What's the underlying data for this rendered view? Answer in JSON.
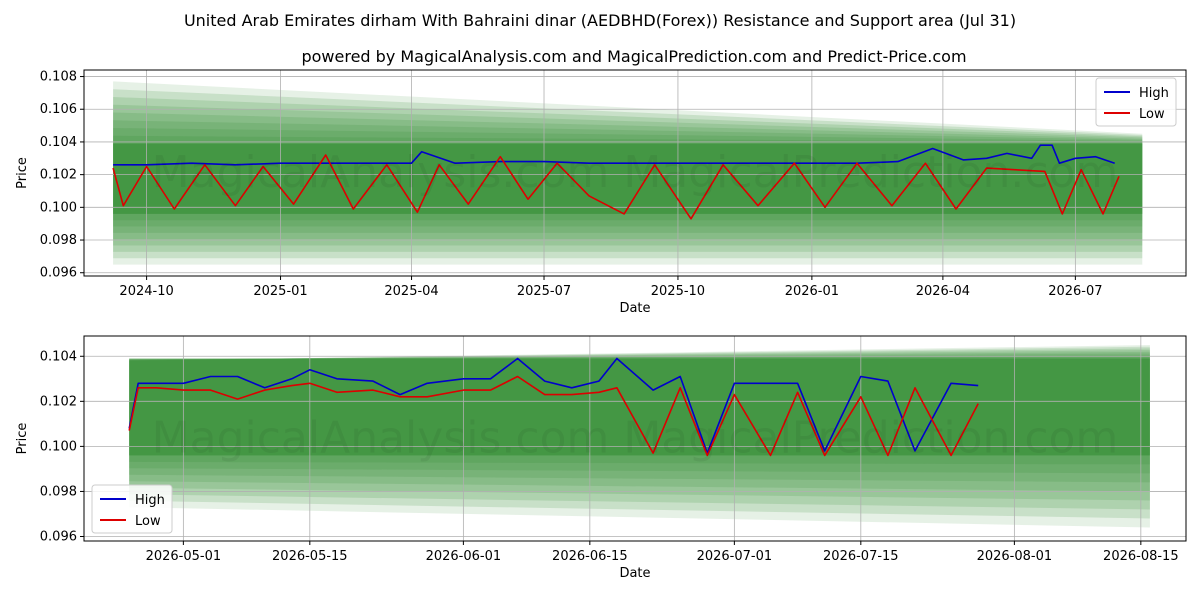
{
  "title_line1": "United Arab Emirates dirham With Bahraini dinar (AEDBHD(Forex)) Resistance and Support area (Jul 31)",
  "title_line2": "powered by MagicalAnalysis.com and MagicalPrediction.com and Predict-Price.com",
  "watermark": "MagicalAnalysis.com   MagicalPrediction.com",
  "colors": {
    "high": "#0000cc",
    "low": "#dd0000",
    "band": "#2e8b2e"
  },
  "chart_data": [
    {
      "type": "line",
      "xlabel": "Date",
      "ylabel": "Price",
      "xlim": [
        "2024-08-19",
        "2026-09-15"
      ],
      "ylim": [
        0.0958,
        0.1084
      ],
      "x_ticks": [
        "2024-10",
        "2025-01",
        "2025-04",
        "2025-07",
        "2025-10",
        "2026-01",
        "2026-04",
        "2026-07"
      ],
      "y_ticks": [
        "0.096",
        "0.098",
        "0.100",
        "0.102",
        "0.104",
        "0.106",
        "0.108"
      ],
      "legend": {
        "position": "top-right",
        "entries": [
          "High",
          "Low"
        ]
      },
      "grid": true,
      "band_start": "2024-09-08",
      "band_end": "2026-08-16",
      "band_start_range": [
        0.0965,
        0.1077
      ],
      "band_end_range": [
        0.0965,
        0.1045
      ],
      "core_band": [
        0.0996,
        0.1039
      ],
      "series": [
        {
          "name": "High",
          "x": [
            "2024-09-08",
            "2024-10-01",
            "2024-11-01",
            "2024-12-01",
            "2025-01-01",
            "2025-02-01",
            "2025-03-01",
            "2025-04-01",
            "2025-04-08",
            "2025-05-01",
            "2025-06-01",
            "2025-07-01",
            "2025-08-01",
            "2025-09-01",
            "2025-10-01",
            "2025-11-01",
            "2025-12-01",
            "2026-01-01",
            "2026-02-01",
            "2026-03-01",
            "2026-03-25",
            "2026-04-15",
            "2026-05-01",
            "2026-05-15",
            "2026-06-01",
            "2026-06-07",
            "2026-06-15",
            "2026-06-20",
            "2026-07-01",
            "2026-07-15",
            "2026-07-28"
          ],
          "values": [
            0.1026,
            0.1026,
            0.1027,
            0.1026,
            0.1027,
            0.1027,
            0.1027,
            0.1027,
            0.1034,
            0.1027,
            0.1028,
            0.1028,
            0.1027,
            0.1027,
            0.1027,
            0.1027,
            0.1027,
            0.1027,
            0.1027,
            0.1028,
            0.1036,
            0.1029,
            0.103,
            0.1033,
            0.103,
            0.1038,
            0.1038,
            0.1027,
            0.103,
            0.1031,
            0.1027
          ]
        },
        {
          "name": "Low",
          "x": [
            "2024-09-08",
            "2024-09-15",
            "2024-10-01",
            "2024-10-20",
            "2024-11-10",
            "2024-12-01",
            "2024-12-20",
            "2025-01-10",
            "2025-02-01",
            "2025-02-20",
            "2025-03-15",
            "2025-04-05",
            "2025-04-20",
            "2025-05-10",
            "2025-06-01",
            "2025-06-20",
            "2025-07-10",
            "2025-08-01",
            "2025-08-25",
            "2025-09-15",
            "2025-10-10",
            "2025-11-01",
            "2025-11-25",
            "2025-12-20",
            "2026-01-10",
            "2026-02-01",
            "2026-02-25",
            "2026-03-20",
            "2026-04-10",
            "2026-05-01",
            "2026-05-20",
            "2026-06-10",
            "2026-06-22",
            "2026-07-05",
            "2026-07-20",
            "2026-07-31"
          ],
          "values": [
            0.1024,
            0.1001,
            0.1025,
            0.0999,
            0.1026,
            0.1001,
            0.1025,
            0.1002,
            0.1032,
            0.0999,
            0.1026,
            0.0997,
            0.1026,
            0.1002,
            0.1031,
            0.1005,
            0.1027,
            0.1007,
            0.0996,
            0.1026,
            0.0993,
            0.1026,
            0.1001,
            0.1027,
            0.1,
            0.1027,
            0.1001,
            0.1027,
            0.0999,
            0.1024,
            0.1023,
            0.1022,
            0.0996,
            0.1023,
            0.0996,
            0.1019
          ]
        }
      ]
    },
    {
      "type": "line",
      "xlabel": "Date",
      "ylabel": "Price",
      "xlim": [
        "2026-04-20",
        "2026-08-20"
      ],
      "ylim": [
        0.0958,
        0.1049
      ],
      "x_ticks": [
        "2026-05-01",
        "2026-05-15",
        "2026-06-01",
        "2026-06-15",
        "2026-07-01",
        "2026-07-15",
        "2026-08-01",
        "2026-08-15"
      ],
      "y_ticks": [
        "0.096",
        "0.098",
        "0.100",
        "0.102",
        "0.104"
      ],
      "legend": {
        "position": "bottom-left",
        "entries": [
          "High",
          "Low"
        ]
      },
      "grid": true,
      "band_start": "2026-04-25",
      "band_end": "2026-08-16",
      "band_start_range": [
        0.0973,
        0.1038
      ],
      "band_end_range": [
        0.0964,
        0.1045
      ],
      "core_band": [
        0.0996,
        0.1039
      ],
      "series": [
        {
          "name": "High",
          "x": [
            "2026-04-25",
            "2026-04-26",
            "2026-04-28",
            "2026-05-01",
            "2026-05-04",
            "2026-05-07",
            "2026-05-10",
            "2026-05-13",
            "2026-05-15",
            "2026-05-18",
            "2026-05-22",
            "2026-05-25",
            "2026-05-28",
            "2026-06-01",
            "2026-06-04",
            "2026-06-07",
            "2026-06-10",
            "2026-06-13",
            "2026-06-16",
            "2026-06-18",
            "2026-06-22",
            "2026-06-25",
            "2026-06-28",
            "2026-07-01",
            "2026-07-05",
            "2026-07-08",
            "2026-07-11",
            "2026-07-15",
            "2026-07-18",
            "2026-07-21",
            "2026-07-25",
            "2026-07-28"
          ],
          "values": [
            0.1008,
            0.1028,
            0.1028,
            0.1028,
            0.1031,
            0.1031,
            0.1026,
            0.103,
            0.1034,
            0.103,
            0.1029,
            0.1023,
            0.1028,
            0.103,
            0.103,
            0.1039,
            0.1029,
            0.1026,
            0.1029,
            0.1039,
            0.1025,
            0.1031,
            0.0997,
            0.1028,
            0.1028,
            0.1028,
            0.0998,
            0.1031,
            0.1029,
            0.0998,
            0.1028,
            0.1027
          ]
        },
        {
          "name": "Low",
          "x": [
            "2026-04-25",
            "2026-04-26",
            "2026-04-28",
            "2026-05-01",
            "2026-05-04",
            "2026-05-07",
            "2026-05-10",
            "2026-05-13",
            "2026-05-15",
            "2026-05-18",
            "2026-05-22",
            "2026-05-25",
            "2026-05-28",
            "2026-06-01",
            "2026-06-04",
            "2026-06-07",
            "2026-06-10",
            "2026-06-13",
            "2026-06-16",
            "2026-06-18",
            "2026-06-22",
            "2026-06-25",
            "2026-06-28",
            "2026-07-01",
            "2026-07-05",
            "2026-07-08",
            "2026-07-11",
            "2026-07-15",
            "2026-07-18",
            "2026-07-21",
            "2026-07-25",
            "2026-07-28"
          ],
          "values": [
            0.1007,
            0.1026,
            0.1026,
            0.1025,
            0.1025,
            0.1021,
            0.1025,
            0.1027,
            0.1028,
            0.1024,
            0.1025,
            0.1022,
            0.1022,
            0.1025,
            0.1025,
            0.1031,
            0.1023,
            0.1023,
            0.1024,
            0.1026,
            0.0997,
            0.1026,
            0.0996,
            0.1023,
            0.0996,
            0.1024,
            0.0996,
            0.1022,
            0.0996,
            0.1026,
            0.0996,
            0.1019
          ]
        }
      ]
    }
  ]
}
